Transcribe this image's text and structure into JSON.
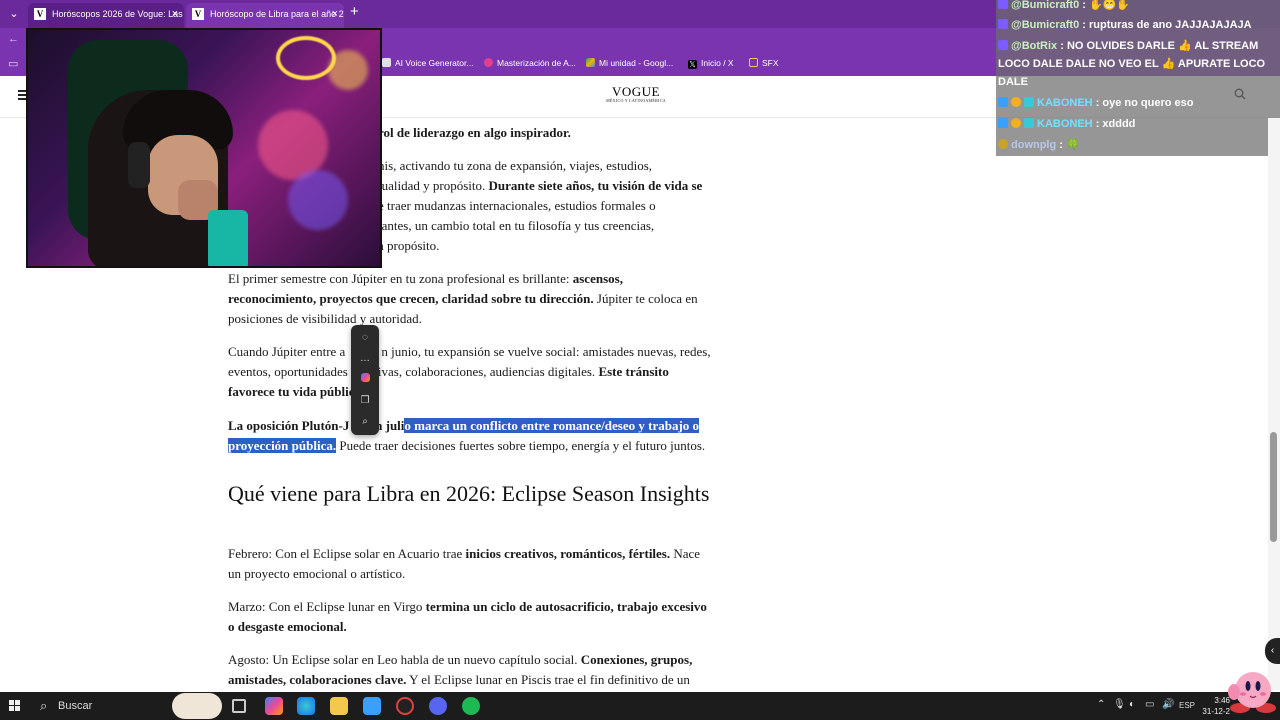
{
  "browser": {
    "tabs": [
      {
        "label": "Horóscopos 2026 de Vogue: Las p",
        "active": false
      },
      {
        "label": "Horóscopo de Libra para el año 20",
        "active": true
      }
    ],
    "bookmarks": [
      {
        "label": "AI Voice Generator...",
        "icon": "document-icon",
        "color": "#e0e0e0"
      },
      {
        "label": "Masterización de A...",
        "icon": "audio-icon",
        "color": "#e0408c"
      },
      {
        "label": "Mi unidad - Googl...",
        "icon": "google-drive-icon",
        "color": "#f5b400"
      },
      {
        "label": "Inicio / X",
        "icon": "x-logo-icon",
        "color": "#000000"
      },
      {
        "label": "SFX",
        "icon": "folder-icon",
        "color": "#f2c94c"
      }
    ]
  },
  "site": {
    "logo_main": "VOGUE",
    "logo_sub": "MÉXICO Y LATINOAMÉRICA"
  },
  "article": {
    "p0_bold": "rol de liderazgo en algo inspirador.",
    "p1_a": "nis, activando tu zona de expansión, viajes, estudios,",
    "p1_b": "tualidad y propósito.",
    "p1_c": "Durante siete años, tu visión de vida se",
    "p1_d": "e traer mudanzas internacionales, estudios formales o",
    "p1_e": "tantes, un cambio total en tu filosofía y tus creencias,",
    "p1_f": "a propósito.",
    "p2_a": "El primer semestre con Júpiter en tu zona profesional es brillante:",
    "p2_b": "ascensos, reconocimiento, proyectos que crecen, claridad sobre tu dirección.",
    "p2_c": "Júpiter te coloca en posiciones de visibilidad y autoridad.",
    "p3_a": "Cuando Júpiter entre a",
    "p3_b": "n junio, tu expansión se vuelve social: amistades nuevas, redes,",
    "p3_c": "eventos, oportunidades",
    "p3_d": "ivas, colaboraciones, audiencias digitales.",
    "p3_e": "Este tránsito favorece tu vida pública.",
    "p4_a": "La oposición Plutón-J",
    "p4_b": "en juli",
    "p4_hl1": "o marca un conflicto entre romance/deseo y trabajo o",
    "p4_hl2": "proyección pública.",
    "p4_c": "Puede traer decisiones fuertes sobre tiempo, energía y el futuro juntos.",
    "h2": "Qué viene para Libra en 2026: Eclipse Season Insights",
    "p5_a": "Febrero: Con el Eclipse solar en Acuario trae",
    "p5_b": "inicios creativos, románticos, fértiles.",
    "p5_c": "Nace un proyecto emocional o artístico.",
    "p6_a": "Marzo: Con el Eclipse lunar en Virgo",
    "p6_b": "termina un ciclo de autosacrificio, trabajo excesivo o desgaste emocional.",
    "p7_a": "Agosto: Un Eclipse solar en Leo habla de un nuevo capítulo social.",
    "p7_b": "Conexiones, grupos, amistades, colaboraciones clave.",
    "p7_c": "Y el Eclipse lunar en Piscis trae el fin definitivo de un"
  },
  "chat": {
    "messages": [
      {
        "user": "@Bumicraft0",
        "text": ": ✋😁✋"
      },
      {
        "user": "@Bumicraft0",
        "text": ": rupturas de ano JAJJAJAJAJA"
      },
      {
        "user": "@BotRix",
        "text": ": NO OLVIDES DARLE 👍 AL STREAM"
      },
      {
        "user": "",
        "text": "LOCO DALE DALE NO VEO EL 👍 APURATE LOCO"
      },
      {
        "user": "",
        "text": "DALE"
      },
      {
        "user": "KABONEH",
        "text": ": oye no quero eso"
      },
      {
        "user": "KABONEH",
        "text": ": xdddd"
      },
      {
        "user": "downplg",
        "text": ": 🍀"
      }
    ]
  },
  "taskbar": {
    "search_placeholder": "Buscar",
    "language": "ESP",
    "time": "3:46",
    "date": "31-12-2"
  }
}
